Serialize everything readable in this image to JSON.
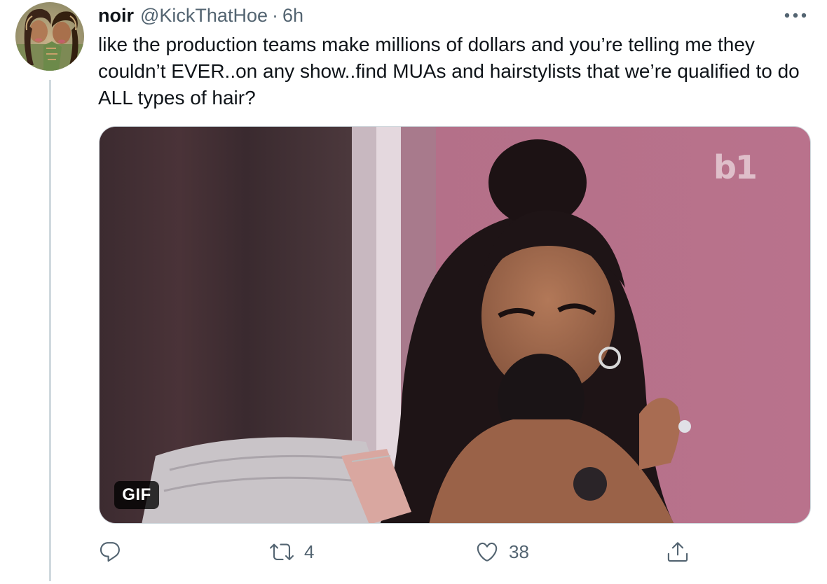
{
  "tweet": {
    "display_name": "noir",
    "handle": "@KickThatHoe",
    "separator": "·",
    "time": "6h",
    "text": "like the production teams make millions of dollars and you’re telling me they couldn’t EVER..on any show..find MUAs and hairstylists that we’re qualified to do ALL types of hair?",
    "media": {
      "badge": "GIF",
      "logo": "b1"
    },
    "actions": {
      "reply": {
        "icon": "reply-icon",
        "count": ""
      },
      "retweet": {
        "icon": "retweet-icon",
        "count": "4"
      },
      "like": {
        "icon": "heart-icon",
        "count": "38"
      },
      "share": {
        "icon": "share-icon",
        "count": ""
      }
    },
    "more_icon": "more-dots-icon"
  },
  "colors": {
    "text_primary": "#0f1419",
    "text_secondary": "#536471",
    "border": "#cfd9de"
  }
}
